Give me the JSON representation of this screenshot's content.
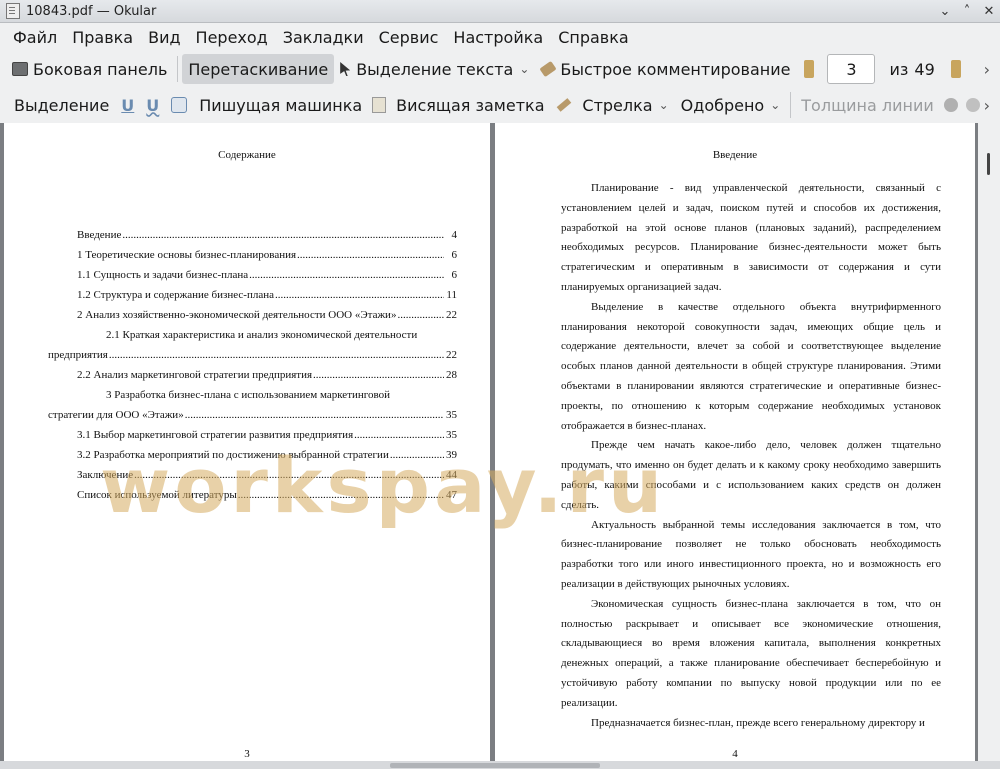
{
  "window": {
    "title": "10843.pdf — Okular",
    "minimize": "⌄",
    "maximize": "˄",
    "close": "✕"
  },
  "menu": [
    "Файл",
    "Правка",
    "Вид",
    "Переход",
    "Закладки",
    "Сервис",
    "Настройка",
    "Справка"
  ],
  "toolbar": {
    "sidebar": "Боковая панель",
    "drag": "Перетаскивание",
    "select_text": "Выделение текста",
    "quick_comment": "Быстрое комментирование",
    "page_current": "3",
    "page_of": "из",
    "page_total": "49"
  },
  "annot_toolbar": {
    "highlight": "Выделение",
    "typewriter": "Пишущая машинка",
    "note": "Висящая заметка",
    "arrow": "Стрелка",
    "stamp": "Одобрено",
    "line_width": "Толщина линии"
  },
  "left_page": {
    "heading": "Содержание",
    "number": "3",
    "toc": [
      {
        "text": "Введение",
        "page": "4"
      },
      {
        "text": "1 Теоретические основы бизнес-планирования",
        "page": "6"
      },
      {
        "text": "1.1 Сущность и задачи бизнес-плана",
        "page": "6"
      },
      {
        "text": "1.2 Структура и содержание бизнес-плана",
        "page": "11"
      },
      {
        "text": "2 Анализ хозяйственно-экономической деятельности ООО «Этажи»",
        "page": "22"
      },
      {
        "text": "2.1 Краткая характеристика и анализ экономической деятельности",
        "page": ""
      },
      {
        "text": "предприятия",
        "page": "22"
      },
      {
        "text": "2.2 Анализ маркетинговой стратегии предприятия",
        "page": "28"
      },
      {
        "text": "3 Разработка бизнес-плана с использованием маркетинговой",
        "page": ""
      },
      {
        "text": "стратегии для ООО «Этажи»",
        "page": "35"
      },
      {
        "text": "3.1 Выбор маркетинговой стратегии развития предприятия",
        "page": "35"
      },
      {
        "text": "3.2 Разработка мероприятий по достижению выбранной стратегии",
        "page": "39"
      },
      {
        "text": "Заключение",
        "page": "44"
      },
      {
        "text": "Список используемой литературы",
        "page": "47"
      }
    ]
  },
  "right_page": {
    "heading": "Введение",
    "number": "4",
    "paragraphs": [
      "Планирование - вид управленческой деятельности, связанный с установлением целей и задач, поиском путей и способов их достижения, разработкой на этой основе планов (плановых заданий), распределением необходимых ресурсов. Планирование бизнес-деятельности может быть стратегическим и оперативным в зависимости от содержания и сути планируемых организацией задач.",
      "Выделение в качестве отдельного объекта внутрифирменного планирования некоторой совокупности задач, имеющих общие цель и содержание деятельности, влечет за собой и соответствующее выделение особых планов данной деятельности в общей структуре планирования. Этими объектами в планировании являются стратегические и оперативные бизнес-проекты, по отношению к которым содержание необходимых установок отображается в бизнес-планах.",
      "Прежде чем начать какое-либо дело, человек должен тщательно продумать, что именно он будет делать и к какому сроку необходимо завершить работы, какими способами и с использованием каких средств он должен сделать.",
      "Актуальность выбранной темы исследования заключается в том, что бизнес-планирование позволяет не только обосновать необходимость разработки того или иного инвестиционного проекта, но и возможность его реализации в действующих рыночных условиях.",
      "Экономическая сущность бизнес-плана заключается в том, что он полностью раскрывает и описывает все экономические отношения, складывающиеся во время вложения капитала, выполнения конкретных денежных операций, а также планирование обеспечивает бесперебойную и устойчивую работу компании по выпуску новой продукции или по ее реализации.",
      "Предназначается бизнес-план, прежде всего генеральному директору и"
    ]
  },
  "watermark": "workspay.ru"
}
